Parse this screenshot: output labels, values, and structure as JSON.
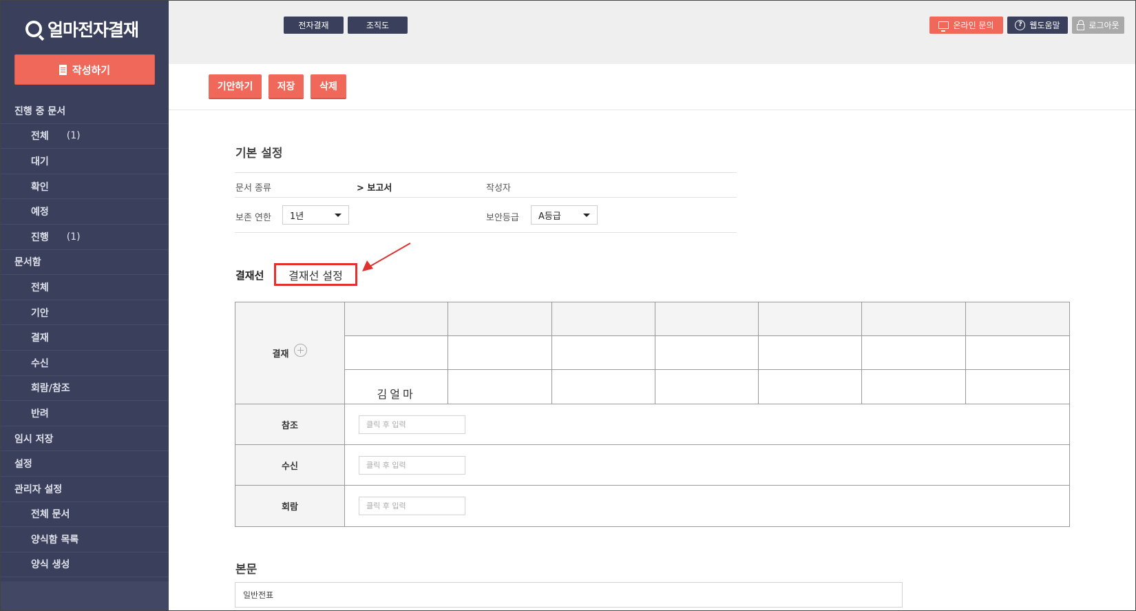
{
  "app": {
    "logo_text": "얼마전자결재",
    "compose_label": "작성하기"
  },
  "sidebar": {
    "items": [
      {
        "label": "진행 중 문서",
        "level": "group",
        "count": ""
      },
      {
        "label": "전체",
        "level": "sub",
        "count": "(1)"
      },
      {
        "label": "대기",
        "level": "sub",
        "count": ""
      },
      {
        "label": "확인",
        "level": "sub",
        "count": ""
      },
      {
        "label": "예정",
        "level": "sub",
        "count": ""
      },
      {
        "label": "진행",
        "level": "sub",
        "count": "(1)"
      },
      {
        "label": "문서함",
        "level": "group",
        "count": ""
      },
      {
        "label": "전체",
        "level": "sub",
        "count": ""
      },
      {
        "label": "기안",
        "level": "sub",
        "count": ""
      },
      {
        "label": "결재",
        "level": "sub",
        "count": ""
      },
      {
        "label": "수신",
        "level": "sub",
        "count": ""
      },
      {
        "label": "회람/참조",
        "level": "sub",
        "count": ""
      },
      {
        "label": "반려",
        "level": "sub",
        "count": ""
      },
      {
        "label": "임시 저장",
        "level": "group",
        "count": ""
      },
      {
        "label": "설정",
        "level": "group",
        "count": ""
      },
      {
        "label": "관리자 설정",
        "level": "group",
        "count": ""
      },
      {
        "label": "전체 문서",
        "level": "sub",
        "count": ""
      },
      {
        "label": "양식함 목록",
        "level": "sub",
        "count": ""
      },
      {
        "label": "양식 생성",
        "level": "sub",
        "count": ""
      }
    ]
  },
  "header": {
    "tabs": [
      "전자결재",
      "조직도"
    ],
    "online_inquiry": "온라인 문의",
    "help": "웹도움말",
    "logout": "로그아웃"
  },
  "actions": {
    "draft": "기안하기",
    "save": "저장",
    "delete": "삭제"
  },
  "basic": {
    "title": "기본 설정",
    "doc_type_label": "문서 종류",
    "doc_type_value": "> 보고서",
    "author_label": "작성자",
    "retention_label": "보존 연한",
    "retention_value": "1년",
    "security_label": "보안등급",
    "security_value": "A등급"
  },
  "approval": {
    "label": "결재선",
    "setting_button": "결재선 설정",
    "row_approve": "결재",
    "signer": "김얼마",
    "rows": [
      {
        "label": "참조",
        "placeholder": "클릭 후 입력"
      },
      {
        "label": "수신",
        "placeholder": "클릭 후 입력"
      },
      {
        "label": "회람",
        "placeholder": "클릭 후 입력"
      }
    ]
  },
  "body": {
    "title": "본문",
    "value": "일반전표"
  },
  "colors": {
    "sidebar_bg": "#3a3f5c",
    "accent": "#f0685a",
    "highlight_red": "#e0312f",
    "logout_gray": "#a9a9a9"
  }
}
